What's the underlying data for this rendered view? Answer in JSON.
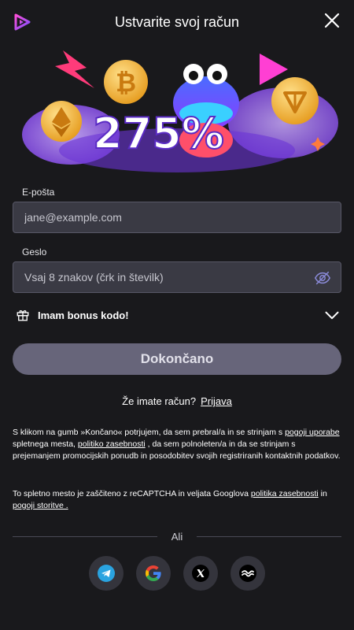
{
  "header": {
    "title": "Ustvarite svoj račun"
  },
  "banner": {
    "promo_text": "275%"
  },
  "form": {
    "email_label": "E-pošta",
    "email_placeholder": "jane@example.com",
    "password_label": "Geslo",
    "password_placeholder": "Vsaj 8 znakov (črk in številk)",
    "bonus_label": "Imam bonus kodo!",
    "submit_label": "Dokončano"
  },
  "login": {
    "question": "Že imate račun?",
    "link": "Prijava"
  },
  "terms": {
    "p1_a": "S klikom na gumb »Končano« potrjujem, da sem prebral/a in se strinjam s ",
    "p1_link1": "pogoji uporabe",
    "p1_b": " spletnega mesta, ",
    "p1_link2": "politiko zasebnosti",
    "p1_c": " , da sem polnoleten/a in da se strinjam s prejemanjem promocijskih ponudb in posodobitev svojih registriranih kontaktnih podatkov.",
    "p2_a": "To spletno mesto je zaščiteno z reCAPTCHA in veljata Googlova ",
    "p2_link1": "politika zasebnosti",
    "p2_b": " in ",
    "p2_link2": "pogoji storitve .",
    "p2_c": ""
  },
  "divider": {
    "text": "Ali"
  },
  "socials": [
    {
      "icon": "telegram-icon"
    },
    {
      "icon": "google-icon"
    },
    {
      "icon": "x-icon"
    },
    {
      "icon": "wallet-icon"
    }
  ],
  "colors": {
    "background": "#19191c",
    "input_bg": "#3a3a44",
    "button_bg": "#67657a",
    "brand": "#c54bff"
  }
}
